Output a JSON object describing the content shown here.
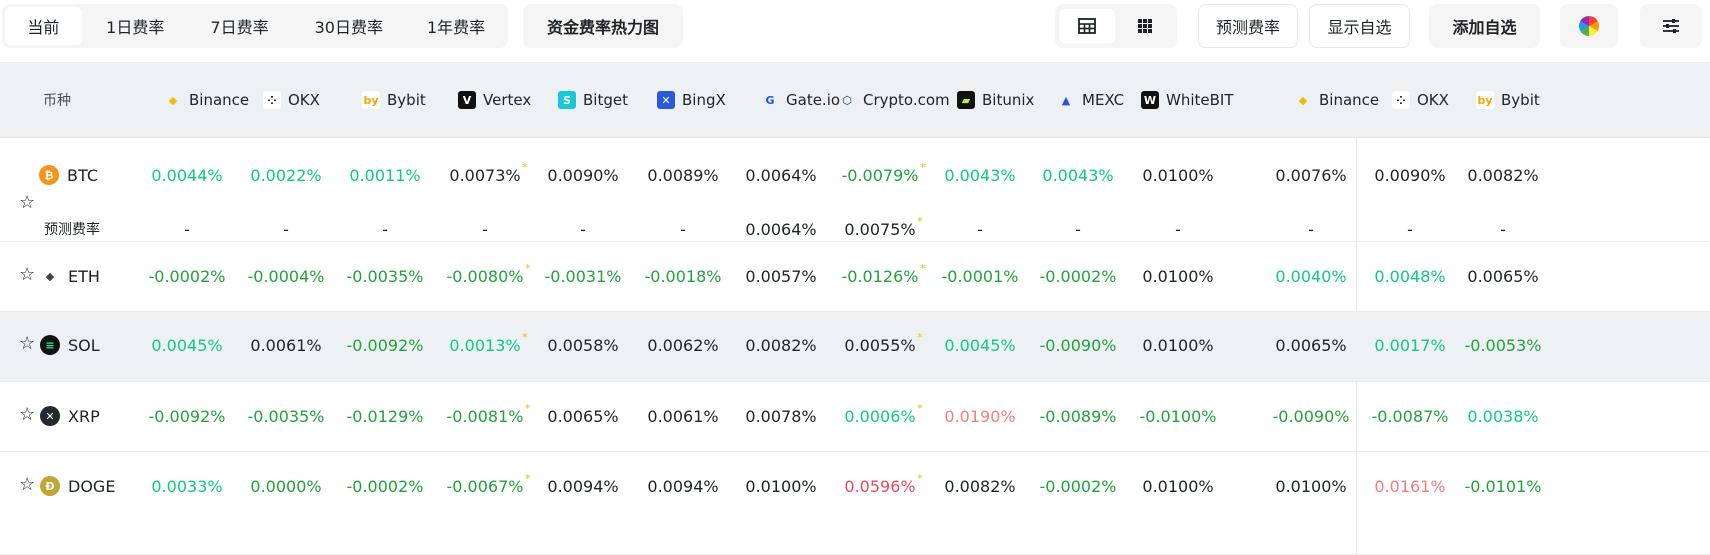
{
  "tabs": [
    "当前",
    "1日费率",
    "7日费率",
    "30日费率",
    "1年费率"
  ],
  "buttons": {
    "heatmap": "资金费率热力图",
    "predict": "预测费率",
    "show_fav": "显示自选",
    "add_fav": "添加自选"
  },
  "icons": {
    "table_view": "table-icon",
    "grid_view": "grid-icon",
    "color": "color-wheel-icon",
    "settings": "sliders-icon"
  },
  "header": {
    "coin": "币种",
    "exchanges": [
      "Binance",
      "OKX",
      "Bybit",
      "Vertex",
      "Bitget",
      "BingX",
      "Gate.io",
      "Crypto.com",
      "Bitunix",
      "MEXC",
      "WhiteBIT",
      "Binance",
      "OKX",
      "Bybit"
    ]
  },
  "rows": [
    {
      "coin": "BTC",
      "values": [
        "0.0044%",
        "0.0022%",
        "0.0011%",
        "0.0073%",
        "0.0090%",
        "0.0089%",
        "0.0064%",
        "-0.0079%",
        "0.0043%",
        "0.0043%",
        "0.0100%",
        "0.0076%",
        "0.0090%",
        "0.0082%"
      ],
      "predict_label": "预测费率",
      "predict": [
        "-",
        "-",
        "-",
        "-",
        "-",
        "-",
        "0.0064%",
        "0.0075%",
        "-",
        "-",
        "-",
        "-",
        "-",
        "-"
      ]
    },
    {
      "coin": "ETH",
      "values": [
        "-0.0002%",
        "-0.0004%",
        "-0.0035%",
        "-0.0080%",
        "-0.0031%",
        "-0.0018%",
        "0.0057%",
        "-0.0126%",
        "-0.0001%",
        "-0.0002%",
        "0.0100%",
        "0.0040%",
        "0.0048%",
        "0.0065%"
      ]
    },
    {
      "coin": "SOL",
      "values": [
        "0.0045%",
        "0.0061%",
        "-0.0092%",
        "0.0013%",
        "0.0058%",
        "0.0062%",
        "0.0082%",
        "0.0055%",
        "0.0045%",
        "-0.0090%",
        "0.0100%",
        "0.0065%",
        "0.0017%",
        "-0.0053%"
      ]
    },
    {
      "coin": "XRP",
      "values": [
        "-0.0092%",
        "-0.0035%",
        "-0.0129%",
        "-0.0081%",
        "0.0065%",
        "0.0061%",
        "0.0078%",
        "0.0006%",
        "0.0190%",
        "-0.0089%",
        "-0.0100%",
        "-0.0090%",
        "-0.0087%",
        "0.0038%"
      ]
    },
    {
      "coin": "DOGE",
      "values": [
        "0.0033%",
        "0.0000%",
        "-0.0002%",
        "-0.0067%",
        "0.0094%",
        "0.0094%",
        "0.0100%",
        "0.0596%",
        "0.0082%",
        "-0.0002%",
        "0.0100%",
        "0.0100%",
        "0.0161%",
        "-0.0101%"
      ]
    }
  ],
  "colors": {
    "positive": "#0ecb81",
    "negative": "#20a33a",
    "high": "#e84a5f",
    "accent_star": "#f0b90b"
  }
}
